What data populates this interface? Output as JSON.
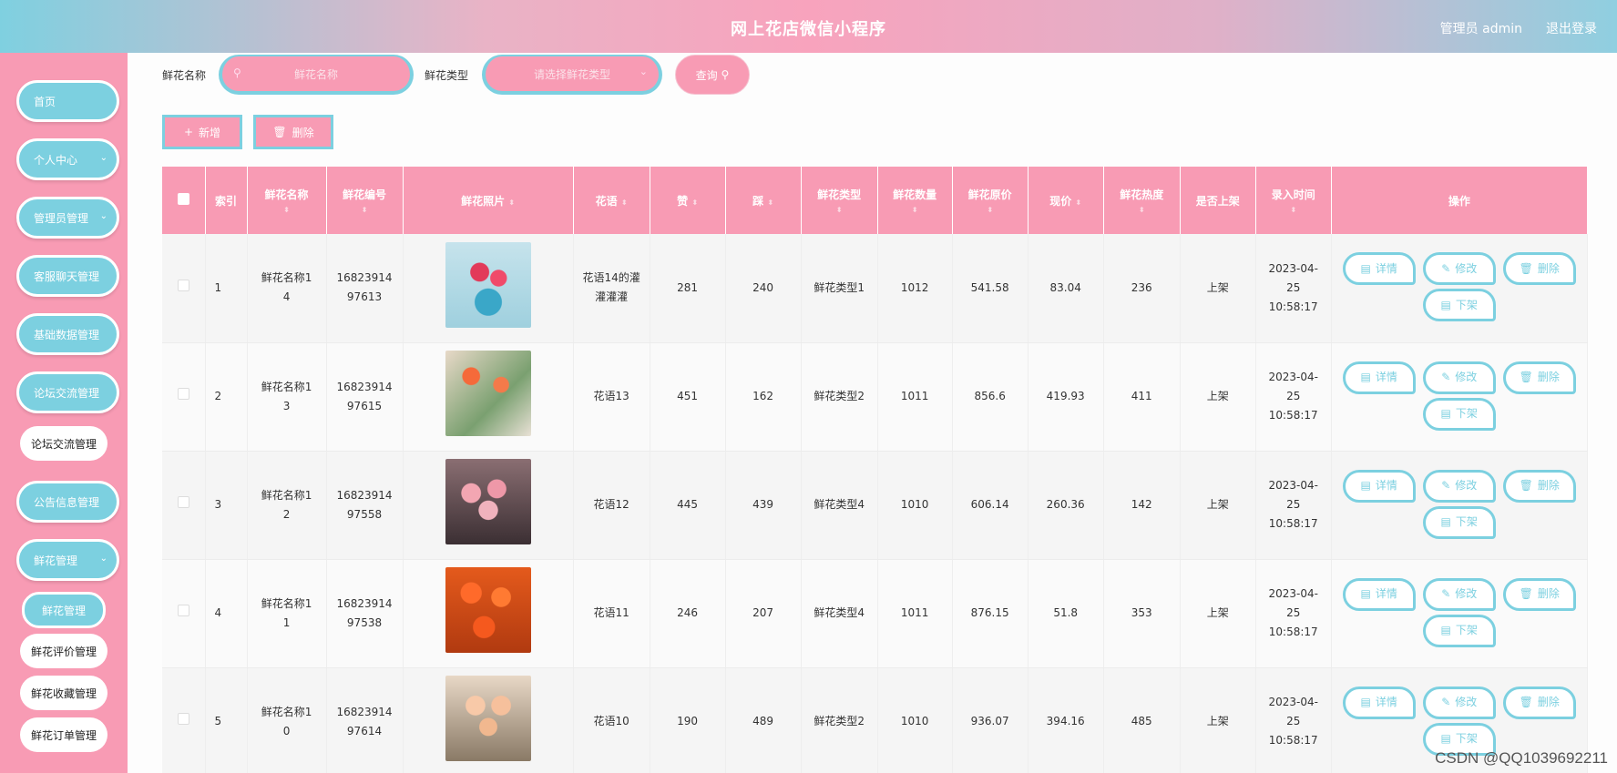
{
  "header": {
    "title": "网上花店微信小程序",
    "admin": "管理员 admin",
    "logout": "退出登录"
  },
  "sidebar": {
    "menu": [
      "首页",
      "个人中心",
      "管理员管理",
      "客服聊天管理",
      "基础数据管理",
      "论坛交流管理",
      "公告信息管理",
      "鲜花管理"
    ],
    "forum_sub": [
      "论坛交流管理"
    ],
    "flower_sub": [
      "鲜花管理",
      "鲜花评价管理",
      "鲜花收藏管理",
      "鲜花订单管理"
    ]
  },
  "search": {
    "name_label": "鲜花名称",
    "name_placeholder": "鲜花名称",
    "type_label": "鲜花类型",
    "type_placeholder": "请选择鲜花类型",
    "query": "查询"
  },
  "actions": {
    "add": "新增",
    "delete": "删除"
  },
  "table": {
    "headers": [
      "索引",
      "鲜花名称",
      "鲜花编号",
      "鲜花照片",
      "花语",
      "赞",
      "踩",
      "鲜花类型",
      "鲜花数量",
      "鲜花原价",
      "现价",
      "鲜花热度",
      "是否上架",
      "录入时间",
      "操作"
    ],
    "op_labels": {
      "detail": "详情",
      "edit": "修改",
      "delete": "删除",
      "offshelf": "下架"
    },
    "rows": [
      {
        "index": "1",
        "name": "鲜花名称14",
        "code": "1682391497613",
        "lang": "花语14的灌灌灌灌",
        "like": "281",
        "dislike": "240",
        "type": "鲜花类型1",
        "qty": "1012",
        "orig": "541.58",
        "price": "83.04",
        "heat": "236",
        "shelf": "上架",
        "time": "2023-04-25 10:58:17"
      },
      {
        "index": "2",
        "name": "鲜花名称13",
        "code": "1682391497615",
        "lang": "花语13",
        "like": "451",
        "dislike": "162",
        "type": "鲜花类型2",
        "qty": "1011",
        "orig": "856.6",
        "price": "419.93",
        "heat": "411",
        "shelf": "上架",
        "time": "2023-04-25 10:58:17"
      },
      {
        "index": "3",
        "name": "鲜花名称12",
        "code": "1682391497558",
        "lang": "花语12",
        "like": "445",
        "dislike": "439",
        "type": "鲜花类型4",
        "qty": "1010",
        "orig": "606.14",
        "price": "260.36",
        "heat": "142",
        "shelf": "上架",
        "time": "2023-04-25 10:58:17"
      },
      {
        "index": "4",
        "name": "鲜花名称11",
        "code": "1682391497538",
        "lang": "花语11",
        "like": "246",
        "dislike": "207",
        "type": "鲜花类型4",
        "qty": "1011",
        "orig": "876.15",
        "price": "51.8",
        "heat": "353",
        "shelf": "上架",
        "time": "2023-04-25 10:58:17"
      },
      {
        "index": "5",
        "name": "鲜花名称10",
        "code": "1682391497614",
        "lang": "花语10",
        "like": "190",
        "dislike": "489",
        "type": "鲜花类型2",
        "qty": "1010",
        "orig": "936.07",
        "price": "394.16",
        "heat": "485",
        "shelf": "上架",
        "time": "2023-04-25 10:58:17"
      }
    ]
  },
  "watermark": "CSDN @QQ1039692211",
  "colors": {
    "pink": "#f89bb4",
    "teal": "#7cd0e0"
  }
}
